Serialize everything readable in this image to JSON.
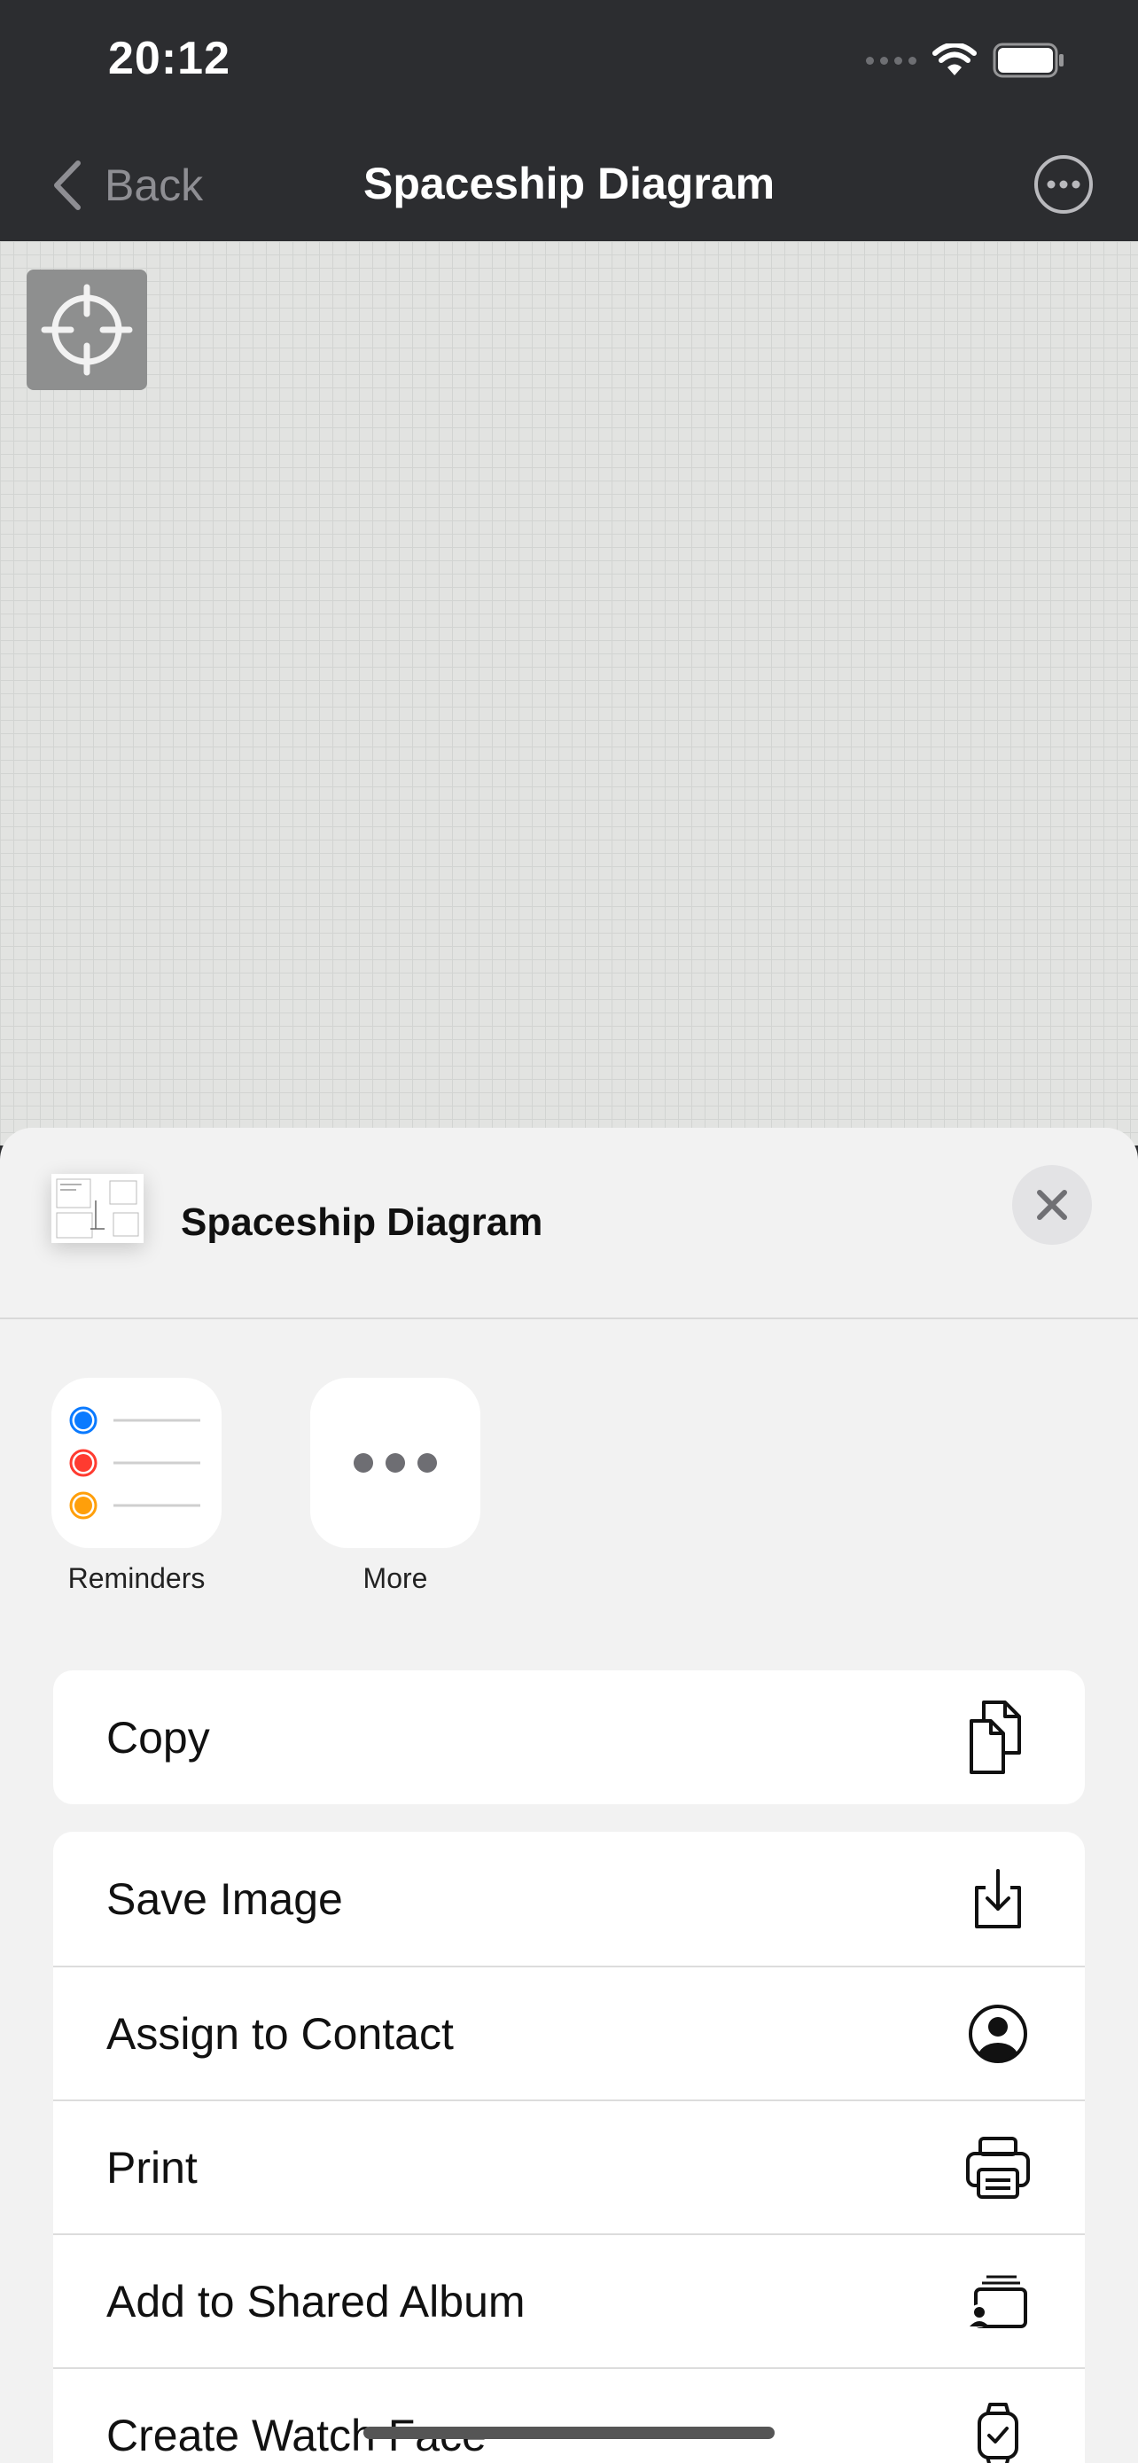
{
  "status_bar": {
    "time": "20:12"
  },
  "nav": {
    "back_label": "Back",
    "title": "Spaceship Diagram"
  },
  "share_sheet": {
    "title": "Spaceship Diagram",
    "apps": [
      {
        "label": "Reminders",
        "icon": "reminders-app-icon"
      },
      {
        "label": "More",
        "icon": "more-dots-icon"
      }
    ],
    "actions": [
      {
        "label": "Copy",
        "icon": "copy-icon"
      },
      {
        "label": "Save Image",
        "icon": "save-image-icon"
      },
      {
        "label": "Assign to Contact",
        "icon": "contact-icon"
      },
      {
        "label": "Print",
        "icon": "printer-icon"
      },
      {
        "label": "Add to Shared Album",
        "icon": "shared-album-icon"
      },
      {
        "label": "Create Watch Face",
        "icon": "watch-icon"
      }
    ]
  },
  "colors": {
    "nav_background": "#2c2d30",
    "sheet_background": "#f2f2f2",
    "reminders_blue": "#0a7aff",
    "reminders_red": "#ff3b30",
    "reminders_orange": "#ff9f0a"
  }
}
